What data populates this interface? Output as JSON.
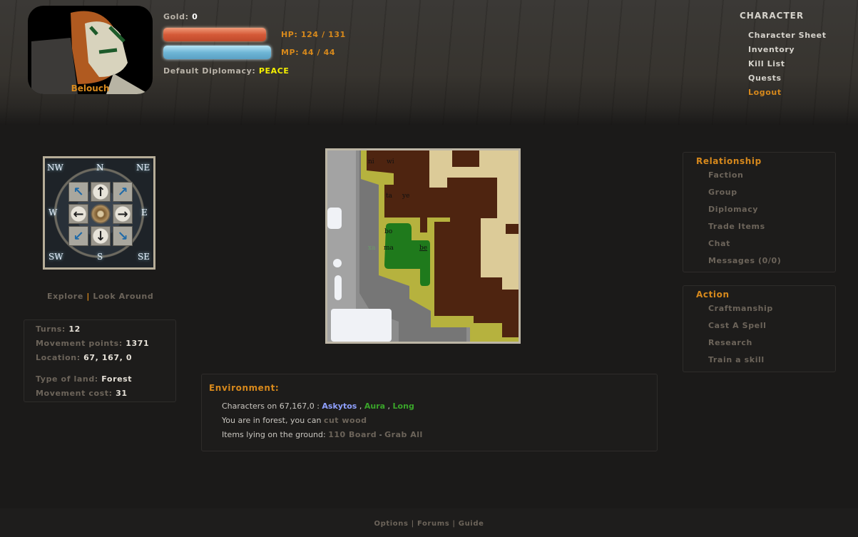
{
  "character": {
    "name": "Belouch",
    "gold_label": "Gold:",
    "gold": "0",
    "hp": "HP: 124 / 131",
    "hp_fraction": 0.947,
    "mp": "MP: 44 / 44",
    "mp_fraction": 1.0,
    "diplomacy_label": "Default Diplomacy:",
    "diplomacy": "PEACE",
    "hp_color": "#d55a38",
    "mp_color": "#6fb6d6"
  },
  "char_menu": {
    "title": "CHARACTER",
    "items": [
      "Character Sheet",
      "Inventory",
      "Kill List",
      "Quests",
      "Logout"
    ]
  },
  "compass": {
    "labels": {
      "nw": "NW",
      "n": "N",
      "ne": "NE",
      "w": "W",
      "e": "E",
      "sw": "SW",
      "s": "S",
      "se": "SE"
    },
    "icons": [
      "arrow-nw",
      "arrow-n",
      "arrow-ne",
      "arrow-w",
      "center",
      "arrow-e",
      "arrow-sw",
      "arrow-s",
      "arrow-se"
    ]
  },
  "explore": {
    "explore": "Explore",
    "sep": "|",
    "look": "Look Around"
  },
  "stats": {
    "turns_label": "Turns:",
    "turns": "12",
    "mp_label": "Movement points:",
    "mp": "1371",
    "loc_label": "Location:",
    "loc": "67, 167, 0",
    "land_label": "Type of land:",
    "land": "Forest",
    "cost_label": "Movement cost:",
    "cost": "31"
  },
  "map": {
    "labels": [
      "ni",
      "wi",
      "ta",
      "ye",
      "bo",
      "xa",
      "ma",
      "be"
    ]
  },
  "environment": {
    "title": "Environment:",
    "chars_prefix": "Characters on 67,167,0 :",
    "chars": [
      "Askytos",
      "Aura",
      "Long"
    ],
    "comma": ",",
    "forest_text": "You are in forest, you can",
    "forest_action": "cut wood",
    "items_text": "Items lying on the ground:",
    "item": "110 Board",
    "grab_sep": " - ",
    "grab": "Grab All"
  },
  "relationship": {
    "title": "Relationship",
    "items": [
      "Faction",
      "Group",
      "Diplomacy",
      "Trade Items",
      "Chat",
      "Messages (0/0)"
    ]
  },
  "action": {
    "title": "Action",
    "items": [
      "Craftmanship",
      "Cast A Spell",
      "Research",
      "Train a skill"
    ]
  },
  "footer": {
    "links": [
      "Options",
      "Forums",
      "Guide"
    ],
    "sep": "|"
  }
}
